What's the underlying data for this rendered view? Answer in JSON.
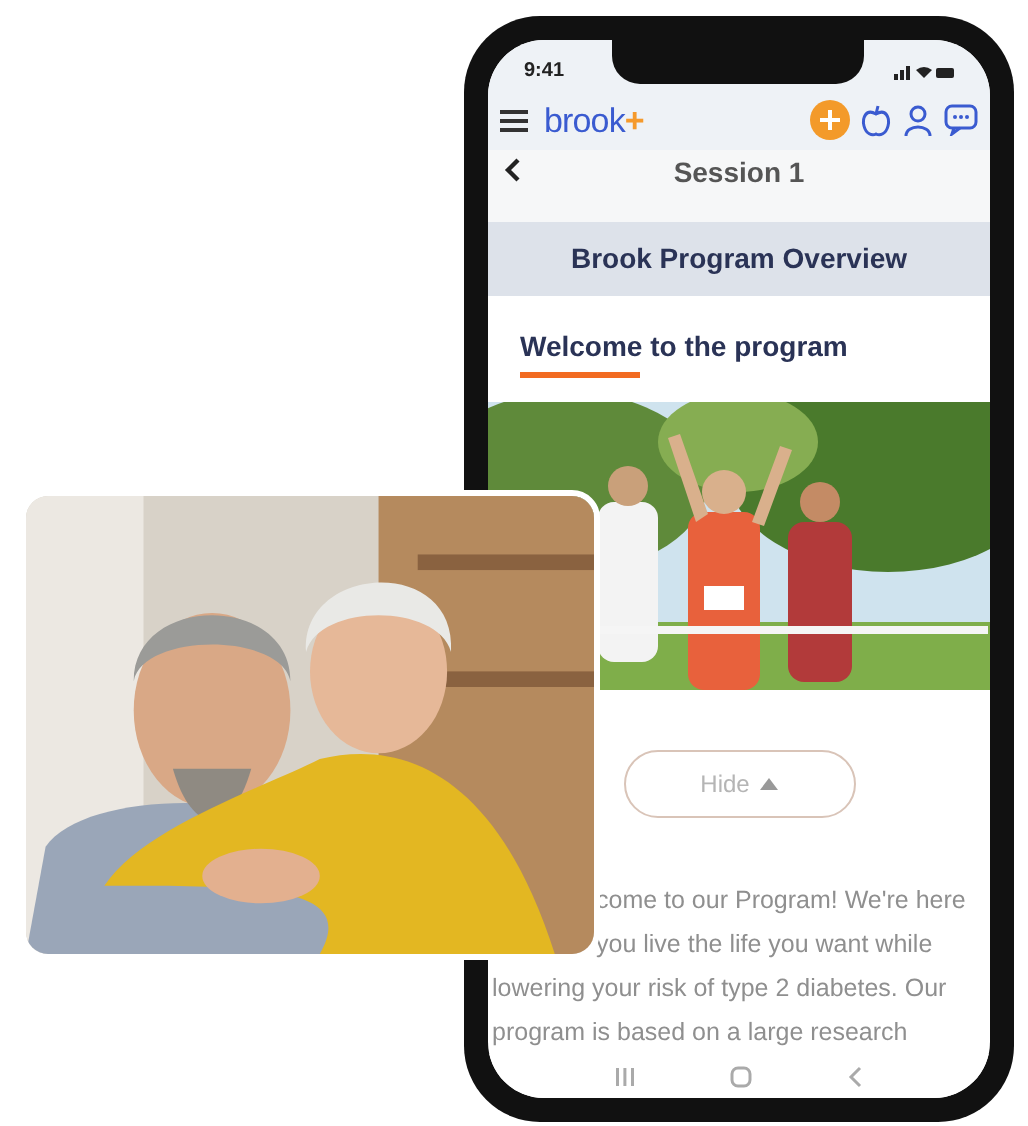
{
  "status_bar": {
    "time": "9:41"
  },
  "app_bar": {
    "logo": {
      "text": "brook",
      "accent": "+"
    }
  },
  "header": {
    "title": "Session 1"
  },
  "section_title": "Brook Program Overview",
  "tab": {
    "label": "Welcome to the program",
    "selected": true
  },
  "hide_button": {
    "label": "Hide"
  },
  "body_lines": [
    {
      "text": "come to our Program! We're here",
      "indent": true
    },
    {
      "text": "you live the life you want while",
      "indent": true
    },
    {
      "text": "lowering your risk of type 2 diabetes. Our",
      "indent": false
    },
    {
      "text": "program is based on a large research",
      "indent": false
    }
  ]
}
